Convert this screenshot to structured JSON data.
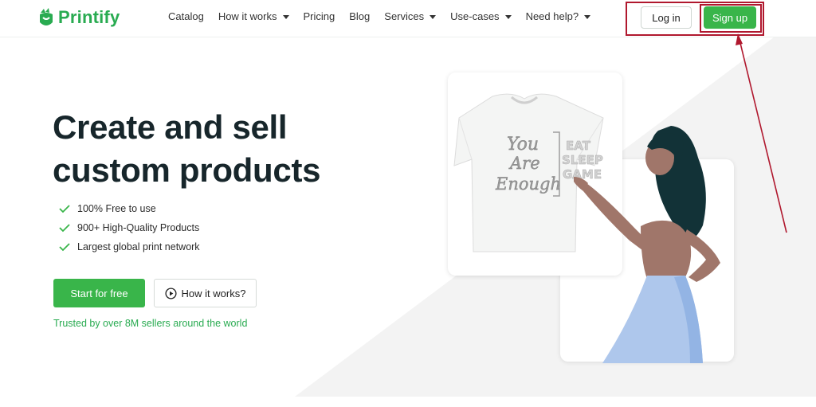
{
  "brand": {
    "name": "Printify",
    "color": "#29ab51"
  },
  "nav": {
    "items": [
      {
        "label": "Catalog",
        "dropdown": false
      },
      {
        "label": "How it works",
        "dropdown": true
      },
      {
        "label": "Pricing",
        "dropdown": false
      },
      {
        "label": "Blog",
        "dropdown": false
      },
      {
        "label": "Services",
        "dropdown": true
      },
      {
        "label": "Use-cases",
        "dropdown": true
      },
      {
        "label": "Need help?",
        "dropdown": true
      }
    ]
  },
  "auth": {
    "login_label": "Log in",
    "signup_label": "Sign up"
  },
  "hero": {
    "title_line1": "Create and sell",
    "title_line2": "custom products",
    "features": [
      "100% Free to use",
      "900+ High-Quality Products",
      "Largest global print network"
    ],
    "start_label": "Start for free",
    "how_label": "How it works?",
    "trusted": "Trusted by over 8M sellers around the world"
  },
  "shirt_print": {
    "left_lines": [
      "You",
      "Are",
      "Enough"
    ],
    "right_lines": [
      "EAT",
      "SLEEP",
      "GAME"
    ]
  },
  "colors": {
    "accent": "#39b54a",
    "annotation": "#b0182e",
    "heading": "#17262b"
  }
}
